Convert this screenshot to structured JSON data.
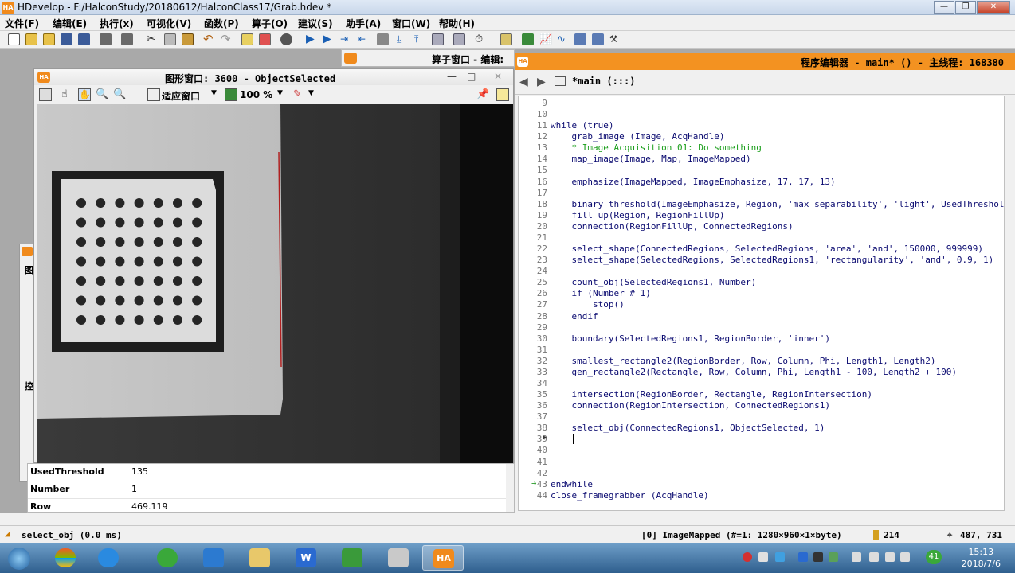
{
  "window": {
    "title": "HDevelop - F:/HalconStudy/20180612/HalconClass17/Grab.hdev *"
  },
  "menu": [
    "文件(F)",
    "编辑(E)",
    "执行(x)",
    "可视化(V)",
    "函数(P)",
    "算子(O)",
    "建议(S)",
    "助手(A)",
    "窗口(W)",
    "帮助(H)"
  ],
  "operator_window": {
    "title": "算子窗口 - 编辑:"
  },
  "graphics_window": {
    "title": "图形窗口: 3600 - ObjectSelected",
    "zoom_mode": "适应窗口",
    "zoom_percent": "100 %"
  },
  "variables": [
    {
      "name": "UsedThreshold",
      "value": "135"
    },
    {
      "name": "Number",
      "value": "1"
    },
    {
      "name": "Row",
      "value": "469.119"
    }
  ],
  "editor": {
    "title": "程序编辑器 - main* () - 主线程: 168380",
    "tab": "*main (:::)",
    "lines": [
      {
        "n": "9",
        "t": ""
      },
      {
        "n": "10",
        "t": ""
      },
      {
        "n": "11",
        "t": "while (true)"
      },
      {
        "n": "12",
        "t": "    grab_image (Image, AcqHandle)"
      },
      {
        "n": "13",
        "t": "    * Image Acquisition 01: Do something"
      },
      {
        "n": "14",
        "t": "    map_image(Image, Map, ImageMapped)"
      },
      {
        "n": "15",
        "t": ""
      },
      {
        "n": "16",
        "t": "    emphasize(ImageMapped, ImageEmphasize, 17, 17, 13)"
      },
      {
        "n": "17",
        "t": ""
      },
      {
        "n": "18",
        "t": "    binary_threshold(ImageEmphasize, Region, 'max_separability', 'light', UsedThreshold)"
      },
      {
        "n": "19",
        "t": "    fill_up(Region, RegionFillUp)"
      },
      {
        "n": "20",
        "t": "    connection(RegionFillUp, ConnectedRegions)"
      },
      {
        "n": "21",
        "t": ""
      },
      {
        "n": "22",
        "t": "    select_shape(ConnectedRegions, SelectedRegions, 'area', 'and', 150000, 999999)"
      },
      {
        "n": "23",
        "t": "    select_shape(SelectedRegions, SelectedRegions1, 'rectangularity', 'and', 0.9, 1)"
      },
      {
        "n": "24",
        "t": ""
      },
      {
        "n": "25",
        "t": "    count_obj(SelectedRegions1, Number)"
      },
      {
        "n": "26",
        "t": "    if (Number # 1)"
      },
      {
        "n": "27",
        "t": "        stop()"
      },
      {
        "n": "28",
        "t": "    endif"
      },
      {
        "n": "29",
        "t": ""
      },
      {
        "n": "30",
        "t": "    boundary(SelectedRegions1, RegionBorder, 'inner')"
      },
      {
        "n": "31",
        "t": ""
      },
      {
        "n": "32",
        "t": "    smallest_rectangle2(RegionBorder, Row, Column, Phi, Length1, Length2)"
      },
      {
        "n": "33",
        "t": "    gen_rectangle2(Rectangle, Row, Column, Phi, Length1 - 100, Length2 + 100)"
      },
      {
        "n": "34",
        "t": ""
      },
      {
        "n": "35",
        "t": "    intersection(RegionBorder, Rectangle, RegionIntersection)"
      },
      {
        "n": "36",
        "t": "    connection(RegionIntersection, ConnectedRegions1)"
      },
      {
        "n": "37",
        "t": ""
      },
      {
        "n": "38",
        "t": "    select_obj(ConnectedRegions1, ObjectSelected, 1)"
      },
      {
        "n": "39",
        "t": ""
      },
      {
        "n": "40",
        "t": ""
      },
      {
        "n": "41",
        "t": ""
      },
      {
        "n": "42",
        "t": ""
      },
      {
        "n": "43",
        "t": "endwhile"
      },
      {
        "n": "44",
        "t": "close_framegrabber (AcqHandle)"
      }
    ]
  },
  "status": {
    "left": "select_obj (0.0 ms)",
    "image_info": "[0] ImageMapped (#=1: 1280×960×1×byte)",
    "gray": "214",
    "coords": "487, 731"
  },
  "clock": {
    "time": "15:13",
    "date": "2018/7/6"
  },
  "taskbar": {
    "tray_badge": "41"
  },
  "colors": {
    "accent": "#f39221",
    "comment": "#1a9e1a",
    "code": "#0a0a70"
  }
}
